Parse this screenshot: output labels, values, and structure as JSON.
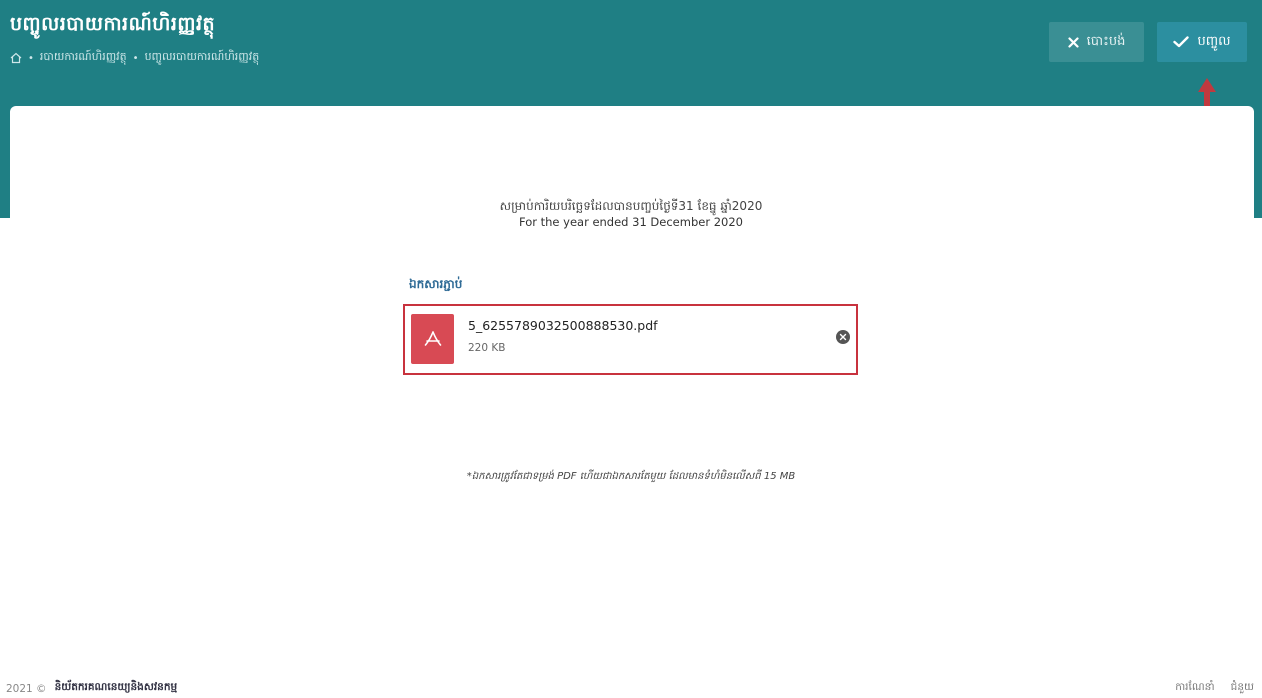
{
  "header": {
    "title": "បញ្ចូលរបាយការណ៍ហិរញ្ញវត្ថុ",
    "breadcrumb": [
      "របាយការណ៍ហិរញ្ញវត្ថុ",
      "បញ្ចូលរបាយការណ៍ហិរញ្ញវត្ថុ"
    ],
    "cancel_label": "បោះបង់",
    "save_label": "បញ្ចូល"
  },
  "content": {
    "subtitle_km": "សម្រាប់ការិយបរិច្ឆេទដែលបានបញ្ចប់ថ្ងៃទី31 ខែធ្នូ ឆ្នាំ2020",
    "subtitle_en": "For the year ended 31 December 2020",
    "attach_label": "ឯកសារភ្ជាប់",
    "file": {
      "name": "5_6255789032500888530.pdf",
      "size": "220 KB"
    },
    "note": "*ឯកសារត្រូវតែជាទម្រង់ PDF ហើយជាឯកសារតែមួយ ដែលមានទំហំមិនលើសពី 15 MB"
  },
  "footer": {
    "year": "2021 ©",
    "brand": "និយ័តករគណនេយ្យនិងសវនកម្ម",
    "links": [
      "ការណែនាំ",
      "ជំនួយ"
    ]
  },
  "colors": {
    "header_bg": "#1f7f84",
    "save_bg": "#2c8fa0",
    "highlight": "#c8323e",
    "pdf_icon": "#d84a54"
  }
}
